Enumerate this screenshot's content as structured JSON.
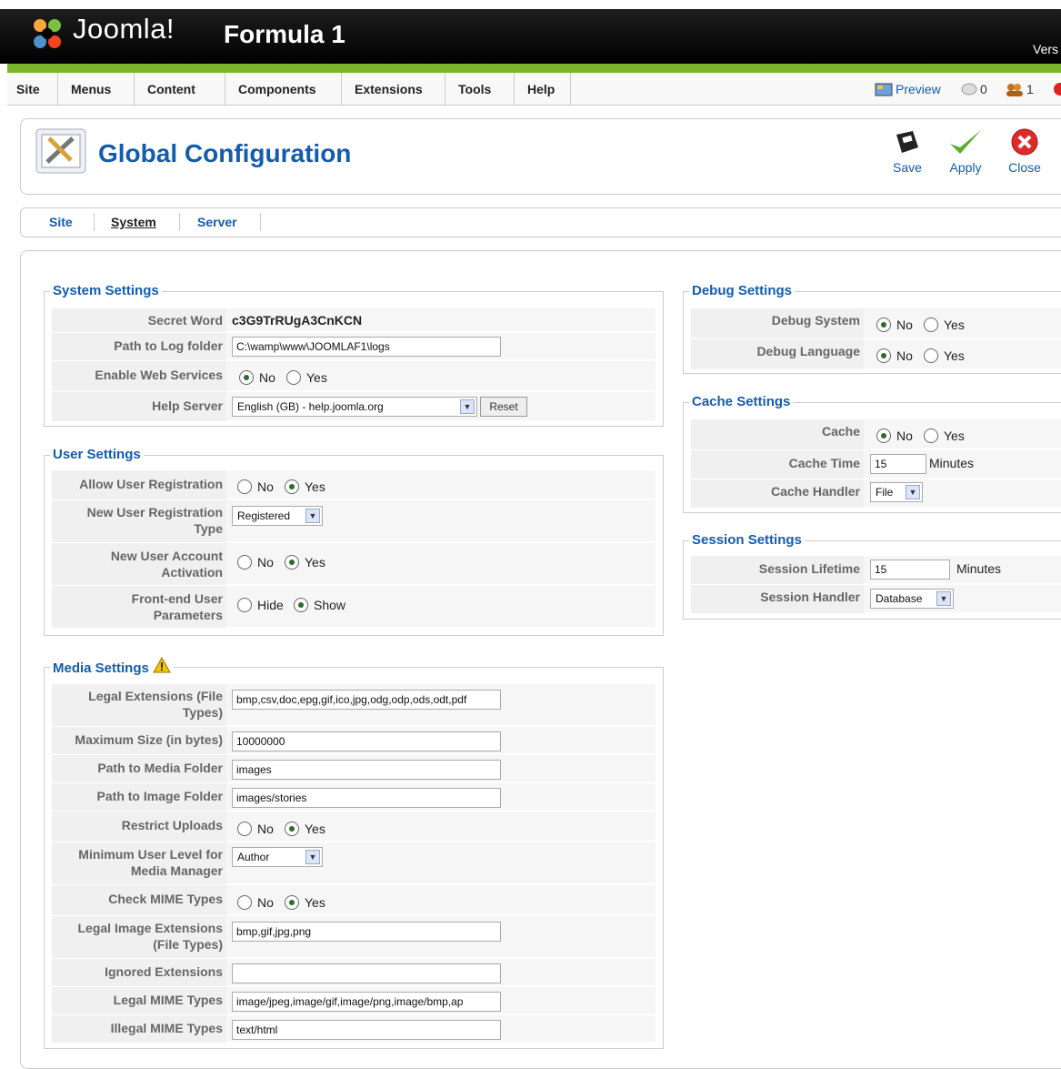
{
  "header": {
    "logo_text": "Joomla!",
    "site_name": "Formula 1",
    "version_label": "Vers"
  },
  "menu": {
    "items": [
      "Site",
      "Menus",
      "Content",
      "Components",
      "Extensions",
      "Tools",
      "Help"
    ],
    "preview_label": "Preview",
    "messages_count": "0",
    "users_count": "1"
  },
  "toolbar": {
    "title": "Global Configuration",
    "save_label": "Save",
    "apply_label": "Apply",
    "close_label": "Close"
  },
  "tabs": [
    {
      "label": "Site",
      "active": false
    },
    {
      "label": "System",
      "active": true
    },
    {
      "label": "Server",
      "active": false
    }
  ],
  "system_settings": {
    "legend": "System Settings",
    "secret_word_label": "Secret Word",
    "secret_word_value": "c3G9TrRUgA3CnKCN",
    "log_path_label": "Path to Log folder",
    "log_path_value": "C:\\wamp\\www\\JOOMLAF1\\logs",
    "web_services_label": "Enable Web Services",
    "help_server_label": "Help Server",
    "help_server_value": "English (GB) - help.joomla.org",
    "reset_label": "Reset"
  },
  "user_settings": {
    "legend": "User Settings",
    "allow_registration_label": "Allow User Registration",
    "registration_type_label_1": "New User Registration",
    "registration_type_label_2": "Type",
    "registration_type_value": "Registered",
    "account_activation_label_1": "New User Account",
    "account_activation_label_2": "Activation",
    "frontend_params_label_1": "Front-end User",
    "frontend_params_label_2": "Parameters"
  },
  "media_settings": {
    "legend": "Media Settings",
    "legal_ext_label_1": "Legal Extensions (File",
    "legal_ext_label_2": "Types)",
    "legal_ext_value": "bmp,csv,doc,epg,gif,ico,jpg,odg,odp,ods,odt,pdf",
    "max_size_label": "Maximum Size (in bytes)",
    "max_size_value": "10000000",
    "media_folder_label": "Path to Media Folder",
    "media_folder_value": "images",
    "image_folder_label": "Path to Image Folder",
    "image_folder_value": "images/stories",
    "restrict_uploads_label": "Restrict Uploads",
    "min_level_label_1": "Minimum User Level for",
    "min_level_label_2": "Media Manager",
    "min_level_value": "Author",
    "check_mime_label": "Check MIME Types",
    "legal_image_ext_label_1": "Legal Image Extensions",
    "legal_image_ext_label_2": "(File Types)",
    "legal_image_ext_value": "bmp,gif,jpg,png",
    "ignored_ext_label": "Ignored Extensions",
    "ignored_ext_value": "",
    "legal_mime_label": "Legal MIME Types",
    "legal_mime_value": "image/jpeg,image/gif,image/png,image/bmp,ap",
    "illegal_mime_label": "Illegal MIME Types",
    "illegal_mime_value": "text/html"
  },
  "debug_settings": {
    "legend": "Debug Settings",
    "debug_system_label": "Debug System",
    "debug_language_label": "Debug Language"
  },
  "cache_settings": {
    "legend": "Cache Settings",
    "cache_label": "Cache",
    "cache_time_label": "Cache Time",
    "cache_time_value": "15",
    "minutes_label": "Minutes",
    "cache_handler_label": "Cache Handler",
    "cache_handler_value": "File"
  },
  "session_settings": {
    "legend": "Session Settings",
    "lifetime_label": "Session Lifetime",
    "lifetime_value": "15",
    "minutes_label": "Minutes",
    "handler_label": "Session Handler",
    "handler_value": "Database"
  },
  "options": {
    "no": "No",
    "yes": "Yes",
    "hide": "Hide",
    "show": "Show"
  },
  "colors": {
    "accent_blue": "#135cae",
    "header_green": "#7ab428"
  }
}
